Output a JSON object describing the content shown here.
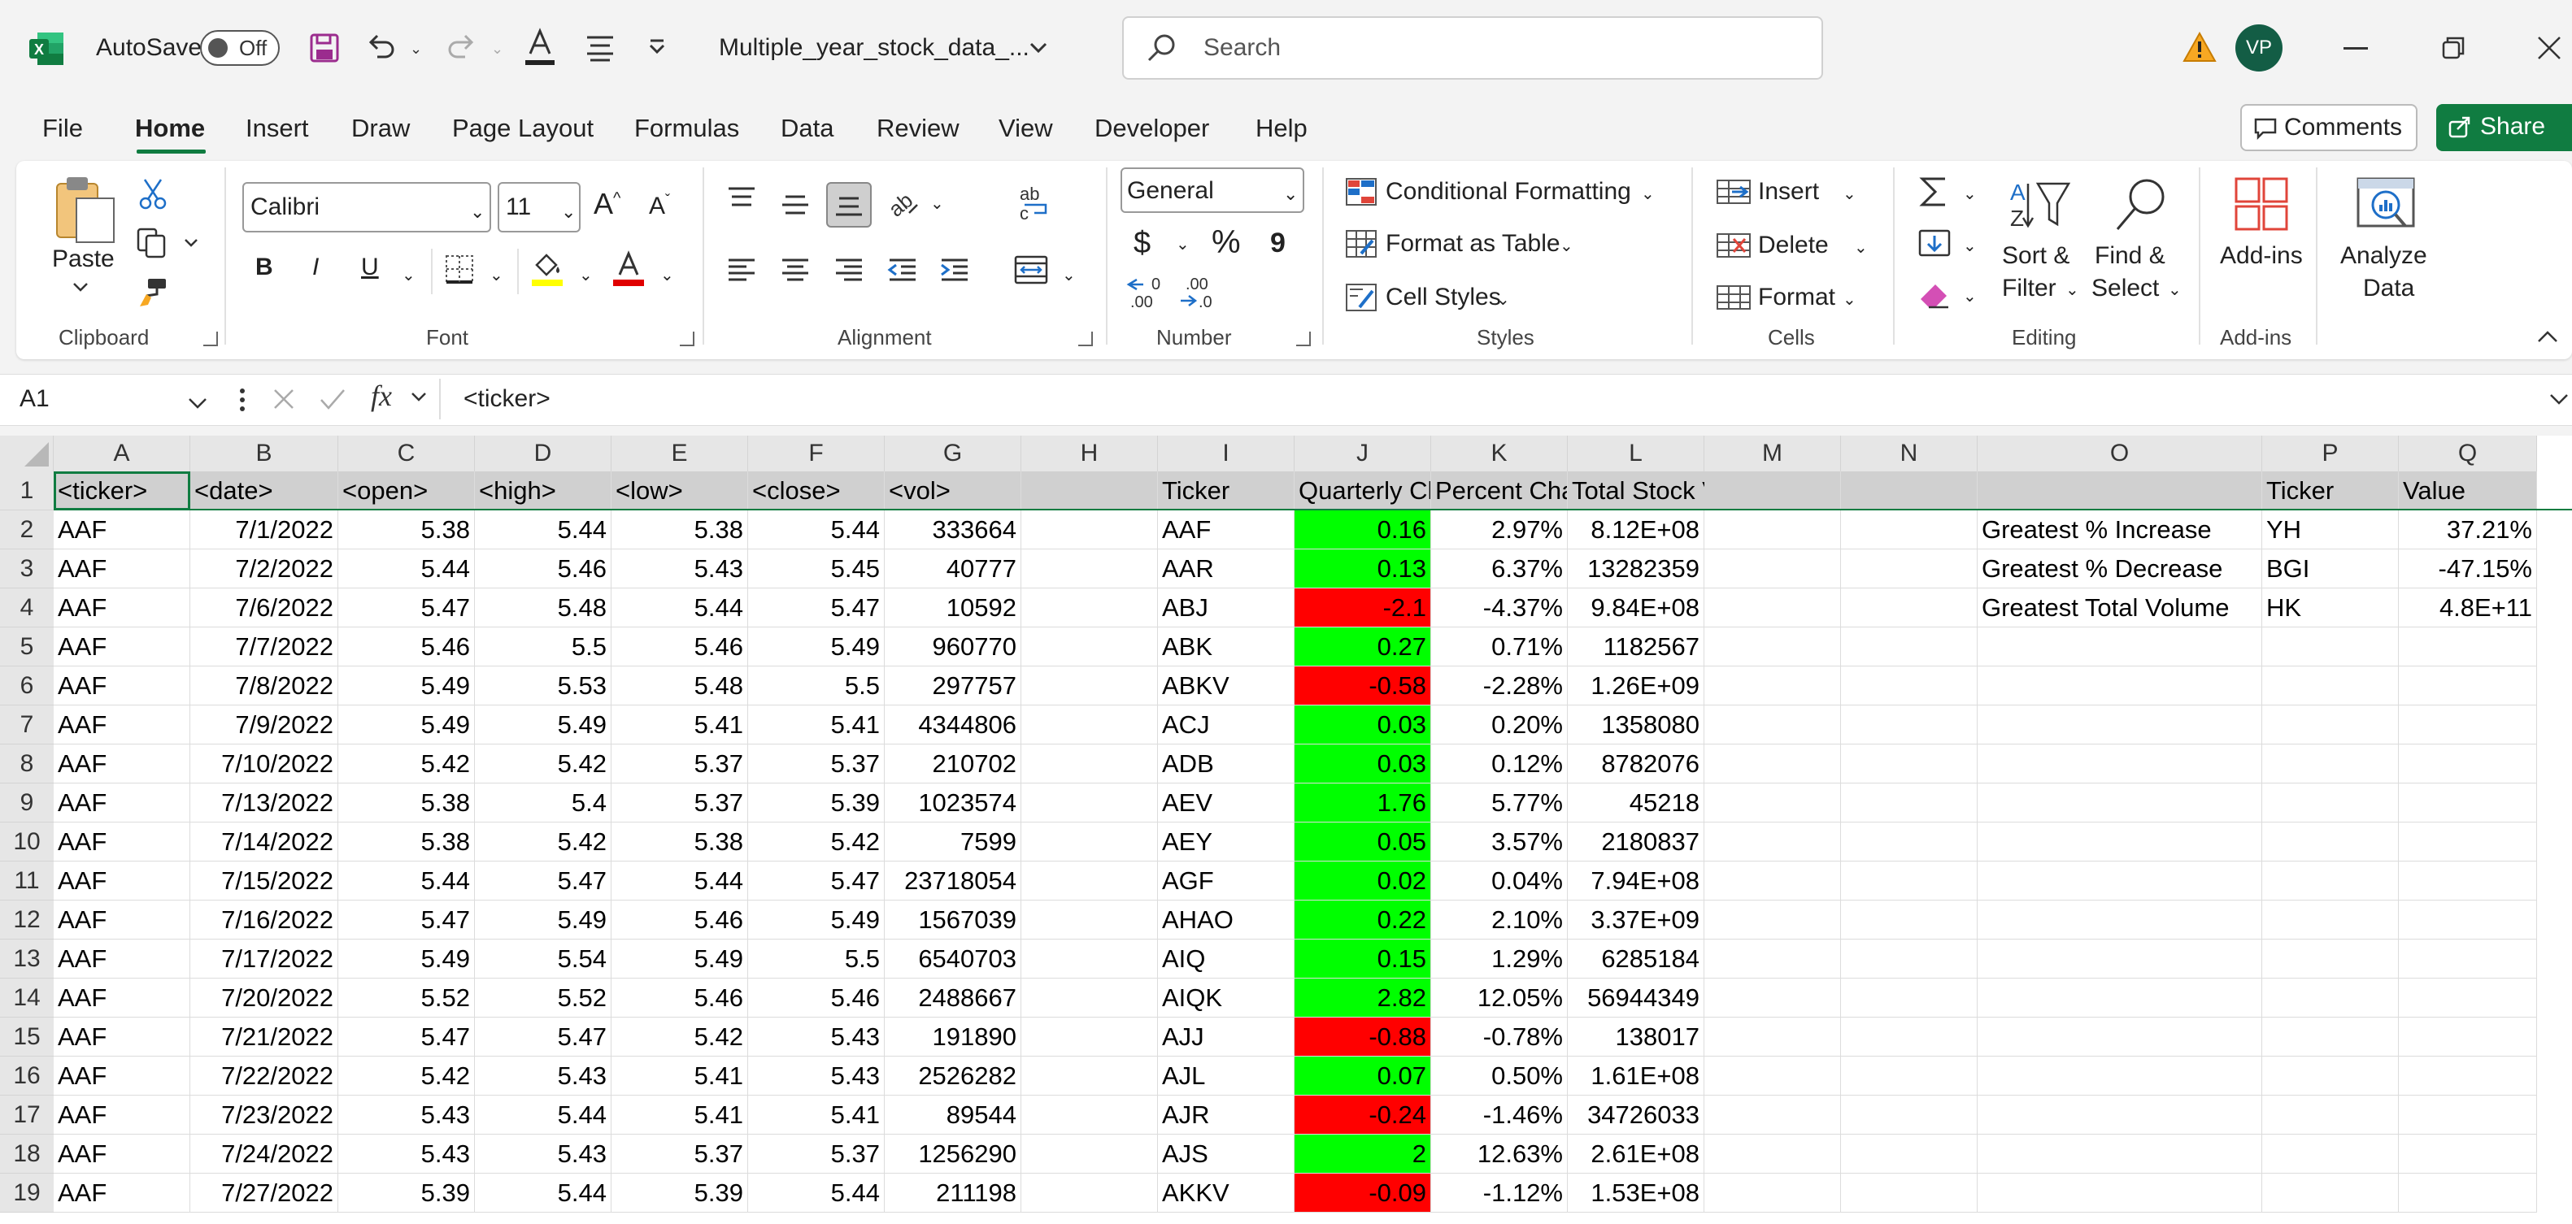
{
  "titlebar": {
    "autosave_label": "AutoSave",
    "autosave_state": "Off",
    "filename": "Multiple_year_stock_data_...",
    "search_placeholder": "Search",
    "user_initials": "VP"
  },
  "tabs": [
    "File",
    "Home",
    "Insert",
    "Draw",
    "Page Layout",
    "Formulas",
    "Data",
    "Review",
    "View",
    "Developer",
    "Help"
  ],
  "active_tab": "Home",
  "actions": {
    "comments": "Comments",
    "share": "Share"
  },
  "ribbon": {
    "clipboard": {
      "label": "Clipboard",
      "paste": "Paste"
    },
    "font": {
      "label": "Font",
      "name": "Calibri",
      "size": "11",
      "bold": "B",
      "italic": "I",
      "underline": "U"
    },
    "alignment": {
      "label": "Alignment"
    },
    "number": {
      "label": "Number",
      "format": "General",
      "currency": "$",
      "percent": "%",
      "comma": "9"
    },
    "styles": {
      "label": "Styles",
      "conditional": "Conditional Formatting",
      "format_table": "Format as Table",
      "cell_styles": "Cell Styles"
    },
    "cells": {
      "label": "Cells",
      "insert": "Insert",
      "delete": "Delete",
      "format": "Format"
    },
    "editing": {
      "label": "Editing",
      "sort1": "Sort &",
      "sort2": "Filter",
      "find1": "Find &",
      "find2": "Select"
    },
    "addins": {
      "label": "Add-ins",
      "addins_btn": "Add-ins",
      "analyze1": "Analyze",
      "analyze2": "Data"
    }
  },
  "formula_bar": {
    "name_box": "A1",
    "fx": "fx",
    "content": "<ticker>"
  },
  "columns": [
    "A",
    "B",
    "C",
    "D",
    "E",
    "F",
    "G",
    "H",
    "I",
    "J",
    "K",
    "L",
    "M",
    "N",
    "O",
    "P",
    "Q"
  ],
  "header_row": {
    "A": "<ticker>",
    "B": "<date>",
    "C": "<open>",
    "D": "<high>",
    "E": "<low>",
    "F": "<close>",
    "G": "<vol>",
    "I": "Ticker",
    "J": "Quarterly Change",
    "K": "Percent Change",
    "L": "Total Stock Volume",
    "P": "Ticker",
    "Q": "Value"
  },
  "rows": [
    {
      "n": "2",
      "A": "AAF",
      "B": "7/1/2022",
      "C": "5.38",
      "D": "5.44",
      "E": "5.38",
      "F": "5.44",
      "G": "333664",
      "I": "AAF",
      "J": "0.16",
      "K": "2.97%",
      "L": "8.12E+08",
      "O": "Greatest % Increase",
      "P": "YH",
      "Q": "37.21%"
    },
    {
      "n": "3",
      "A": "AAF",
      "B": "7/2/2022",
      "C": "5.44",
      "D": "5.46",
      "E": "5.43",
      "F": "5.45",
      "G": "40777",
      "I": "AAR",
      "J": "0.13",
      "K": "6.37%",
      "L": "13282359",
      "O": "Greatest % Decrease",
      "P": "BGI",
      "Q": "-47.15%"
    },
    {
      "n": "4",
      "A": "AAF",
      "B": "7/6/2022",
      "C": "5.47",
      "D": "5.48",
      "E": "5.44",
      "F": "5.47",
      "G": "10592",
      "I": "ABJ",
      "J": "-2.1",
      "K": "-4.37%",
      "L": "9.84E+08",
      "O": "Greatest Total Volume",
      "P": "HK",
      "Q": "4.8E+11"
    },
    {
      "n": "5",
      "A": "AAF",
      "B": "7/7/2022",
      "C": "5.46",
      "D": "5.5",
      "E": "5.46",
      "F": "5.49",
      "G": "960770",
      "I": "ABK",
      "J": "0.27",
      "K": "0.71%",
      "L": "1182567"
    },
    {
      "n": "6",
      "A": "AAF",
      "B": "7/8/2022",
      "C": "5.49",
      "D": "5.53",
      "E": "5.48",
      "F": "5.5",
      "G": "297757",
      "I": "ABKV",
      "J": "-0.58",
      "K": "-2.28%",
      "L": "1.26E+09"
    },
    {
      "n": "7",
      "A": "AAF",
      "B": "7/9/2022",
      "C": "5.49",
      "D": "5.49",
      "E": "5.41",
      "F": "5.41",
      "G": "4344806",
      "I": "ACJ",
      "J": "0.03",
      "K": "0.20%",
      "L": "1358080"
    },
    {
      "n": "8",
      "A": "AAF",
      "B": "7/10/2022",
      "C": "5.42",
      "D": "5.42",
      "E": "5.37",
      "F": "5.37",
      "G": "210702",
      "I": "ADB",
      "J": "0.03",
      "K": "0.12%",
      "L": "8782076"
    },
    {
      "n": "9",
      "A": "AAF",
      "B": "7/13/2022",
      "C": "5.38",
      "D": "5.4",
      "E": "5.37",
      "F": "5.39",
      "G": "1023574",
      "I": "AEV",
      "J": "1.76",
      "K": "5.77%",
      "L": "45218"
    },
    {
      "n": "10",
      "A": "AAF",
      "B": "7/14/2022",
      "C": "5.38",
      "D": "5.42",
      "E": "5.38",
      "F": "5.42",
      "G": "7599",
      "I": "AEY",
      "J": "0.05",
      "K": "3.57%",
      "L": "2180837"
    },
    {
      "n": "11",
      "A": "AAF",
      "B": "7/15/2022",
      "C": "5.44",
      "D": "5.47",
      "E": "5.44",
      "F": "5.47",
      "G": "23718054",
      "I": "AGF",
      "J": "0.02",
      "K": "0.04%",
      "L": "7.94E+08"
    },
    {
      "n": "12",
      "A": "AAF",
      "B": "7/16/2022",
      "C": "5.47",
      "D": "5.49",
      "E": "5.46",
      "F": "5.49",
      "G": "1567039",
      "I": "AHAO",
      "J": "0.22",
      "K": "2.10%",
      "L": "3.37E+09"
    },
    {
      "n": "13",
      "A": "AAF",
      "B": "7/17/2022",
      "C": "5.49",
      "D": "5.54",
      "E": "5.49",
      "F": "5.5",
      "G": "6540703",
      "I": "AIQ",
      "J": "0.15",
      "K": "1.29%",
      "L": "6285184"
    },
    {
      "n": "14",
      "A": "AAF",
      "B": "7/20/2022",
      "C": "5.52",
      "D": "5.52",
      "E": "5.46",
      "F": "5.46",
      "G": "2488667",
      "I": "AIQK",
      "J": "2.82",
      "K": "12.05%",
      "L": "56944349"
    },
    {
      "n": "15",
      "A": "AAF",
      "B": "7/21/2022",
      "C": "5.47",
      "D": "5.47",
      "E": "5.42",
      "F": "5.43",
      "G": "191890",
      "I": "AJJ",
      "J": "-0.88",
      "K": "-0.78%",
      "L": "138017"
    },
    {
      "n": "16",
      "A": "AAF",
      "B": "7/22/2022",
      "C": "5.42",
      "D": "5.43",
      "E": "5.41",
      "F": "5.43",
      "G": "2526282",
      "I": "AJL",
      "J": "0.07",
      "K": "0.50%",
      "L": "1.61E+08"
    },
    {
      "n": "17",
      "A": "AAF",
      "B": "7/23/2022",
      "C": "5.43",
      "D": "5.44",
      "E": "5.41",
      "F": "5.41",
      "G": "89544",
      "I": "AJR",
      "J": "-0.24",
      "K": "-1.46%",
      "L": "34726033"
    },
    {
      "n": "18",
      "A": "AAF",
      "B": "7/24/2022",
      "C": "5.43",
      "D": "5.43",
      "E": "5.37",
      "F": "5.37",
      "G": "1256290",
      "I": "AJS",
      "J": "2",
      "K": "12.63%",
      "L": "2.61E+08"
    },
    {
      "n": "19",
      "A": "AAF",
      "B": "7/27/2022",
      "C": "5.39",
      "D": "5.44",
      "E": "5.39",
      "F": "5.44",
      "G": "211198",
      "I": "AKKV",
      "J": "-0.09",
      "K": "-1.12%",
      "L": "1.53E+08"
    }
  ],
  "colors": {
    "excel_green": "#107c41",
    "positive_fill": "#00ff00",
    "negative_fill": "#ff0000",
    "header_fill": "#d0d0d0"
  }
}
